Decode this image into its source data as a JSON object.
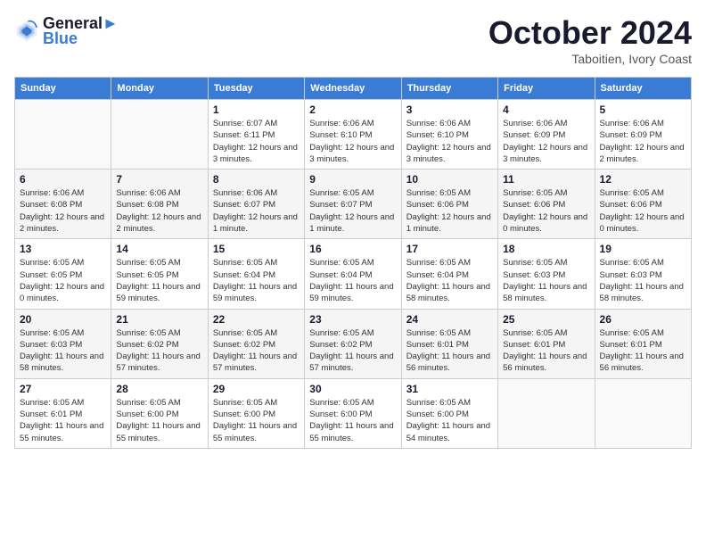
{
  "header": {
    "logo_line1": "General",
    "logo_line2": "Blue",
    "month": "October 2024",
    "location": "Taboitien, Ivory Coast"
  },
  "weekdays": [
    "Sunday",
    "Monday",
    "Tuesday",
    "Wednesday",
    "Thursday",
    "Friday",
    "Saturday"
  ],
  "weeks": [
    [
      {
        "day": "",
        "sunrise": "",
        "sunset": "",
        "daylight": ""
      },
      {
        "day": "",
        "sunrise": "",
        "sunset": "",
        "daylight": ""
      },
      {
        "day": "1",
        "sunrise": "Sunrise: 6:07 AM",
        "sunset": "Sunset: 6:11 PM",
        "daylight": "Daylight: 12 hours and 3 minutes."
      },
      {
        "day": "2",
        "sunrise": "Sunrise: 6:06 AM",
        "sunset": "Sunset: 6:10 PM",
        "daylight": "Daylight: 12 hours and 3 minutes."
      },
      {
        "day": "3",
        "sunrise": "Sunrise: 6:06 AM",
        "sunset": "Sunset: 6:10 PM",
        "daylight": "Daylight: 12 hours and 3 minutes."
      },
      {
        "day": "4",
        "sunrise": "Sunrise: 6:06 AM",
        "sunset": "Sunset: 6:09 PM",
        "daylight": "Daylight: 12 hours and 3 minutes."
      },
      {
        "day": "5",
        "sunrise": "Sunrise: 6:06 AM",
        "sunset": "Sunset: 6:09 PM",
        "daylight": "Daylight: 12 hours and 2 minutes."
      }
    ],
    [
      {
        "day": "6",
        "sunrise": "Sunrise: 6:06 AM",
        "sunset": "Sunset: 6:08 PM",
        "daylight": "Daylight: 12 hours and 2 minutes."
      },
      {
        "day": "7",
        "sunrise": "Sunrise: 6:06 AM",
        "sunset": "Sunset: 6:08 PM",
        "daylight": "Daylight: 12 hours and 2 minutes."
      },
      {
        "day": "8",
        "sunrise": "Sunrise: 6:06 AM",
        "sunset": "Sunset: 6:07 PM",
        "daylight": "Daylight: 12 hours and 1 minute."
      },
      {
        "day": "9",
        "sunrise": "Sunrise: 6:05 AM",
        "sunset": "Sunset: 6:07 PM",
        "daylight": "Daylight: 12 hours and 1 minute."
      },
      {
        "day": "10",
        "sunrise": "Sunrise: 6:05 AM",
        "sunset": "Sunset: 6:06 PM",
        "daylight": "Daylight: 12 hours and 1 minute."
      },
      {
        "day": "11",
        "sunrise": "Sunrise: 6:05 AM",
        "sunset": "Sunset: 6:06 PM",
        "daylight": "Daylight: 12 hours and 0 minutes."
      },
      {
        "day": "12",
        "sunrise": "Sunrise: 6:05 AM",
        "sunset": "Sunset: 6:06 PM",
        "daylight": "Daylight: 12 hours and 0 minutes."
      }
    ],
    [
      {
        "day": "13",
        "sunrise": "Sunrise: 6:05 AM",
        "sunset": "Sunset: 6:05 PM",
        "daylight": "Daylight: 12 hours and 0 minutes."
      },
      {
        "day": "14",
        "sunrise": "Sunrise: 6:05 AM",
        "sunset": "Sunset: 6:05 PM",
        "daylight": "Daylight: 11 hours and 59 minutes."
      },
      {
        "day": "15",
        "sunrise": "Sunrise: 6:05 AM",
        "sunset": "Sunset: 6:04 PM",
        "daylight": "Daylight: 11 hours and 59 minutes."
      },
      {
        "day": "16",
        "sunrise": "Sunrise: 6:05 AM",
        "sunset": "Sunset: 6:04 PM",
        "daylight": "Daylight: 11 hours and 59 minutes."
      },
      {
        "day": "17",
        "sunrise": "Sunrise: 6:05 AM",
        "sunset": "Sunset: 6:04 PM",
        "daylight": "Daylight: 11 hours and 58 minutes."
      },
      {
        "day": "18",
        "sunrise": "Sunrise: 6:05 AM",
        "sunset": "Sunset: 6:03 PM",
        "daylight": "Daylight: 11 hours and 58 minutes."
      },
      {
        "day": "19",
        "sunrise": "Sunrise: 6:05 AM",
        "sunset": "Sunset: 6:03 PM",
        "daylight": "Daylight: 11 hours and 58 minutes."
      }
    ],
    [
      {
        "day": "20",
        "sunrise": "Sunrise: 6:05 AM",
        "sunset": "Sunset: 6:03 PM",
        "daylight": "Daylight: 11 hours and 58 minutes."
      },
      {
        "day": "21",
        "sunrise": "Sunrise: 6:05 AM",
        "sunset": "Sunset: 6:02 PM",
        "daylight": "Daylight: 11 hours and 57 minutes."
      },
      {
        "day": "22",
        "sunrise": "Sunrise: 6:05 AM",
        "sunset": "Sunset: 6:02 PM",
        "daylight": "Daylight: 11 hours and 57 minutes."
      },
      {
        "day": "23",
        "sunrise": "Sunrise: 6:05 AM",
        "sunset": "Sunset: 6:02 PM",
        "daylight": "Daylight: 11 hours and 57 minutes."
      },
      {
        "day": "24",
        "sunrise": "Sunrise: 6:05 AM",
        "sunset": "Sunset: 6:01 PM",
        "daylight": "Daylight: 11 hours and 56 minutes."
      },
      {
        "day": "25",
        "sunrise": "Sunrise: 6:05 AM",
        "sunset": "Sunset: 6:01 PM",
        "daylight": "Daylight: 11 hours and 56 minutes."
      },
      {
        "day": "26",
        "sunrise": "Sunrise: 6:05 AM",
        "sunset": "Sunset: 6:01 PM",
        "daylight": "Daylight: 11 hours and 56 minutes."
      }
    ],
    [
      {
        "day": "27",
        "sunrise": "Sunrise: 6:05 AM",
        "sunset": "Sunset: 6:01 PM",
        "daylight": "Daylight: 11 hours and 55 minutes."
      },
      {
        "day": "28",
        "sunrise": "Sunrise: 6:05 AM",
        "sunset": "Sunset: 6:00 PM",
        "daylight": "Daylight: 11 hours and 55 minutes."
      },
      {
        "day": "29",
        "sunrise": "Sunrise: 6:05 AM",
        "sunset": "Sunset: 6:00 PM",
        "daylight": "Daylight: 11 hours and 55 minutes."
      },
      {
        "day": "30",
        "sunrise": "Sunrise: 6:05 AM",
        "sunset": "Sunset: 6:00 PM",
        "daylight": "Daylight: 11 hours and 55 minutes."
      },
      {
        "day": "31",
        "sunrise": "Sunrise: 6:05 AM",
        "sunset": "Sunset: 6:00 PM",
        "daylight": "Daylight: 11 hours and 54 minutes."
      },
      {
        "day": "",
        "sunrise": "",
        "sunset": "",
        "daylight": ""
      },
      {
        "day": "",
        "sunrise": "",
        "sunset": "",
        "daylight": ""
      }
    ]
  ]
}
